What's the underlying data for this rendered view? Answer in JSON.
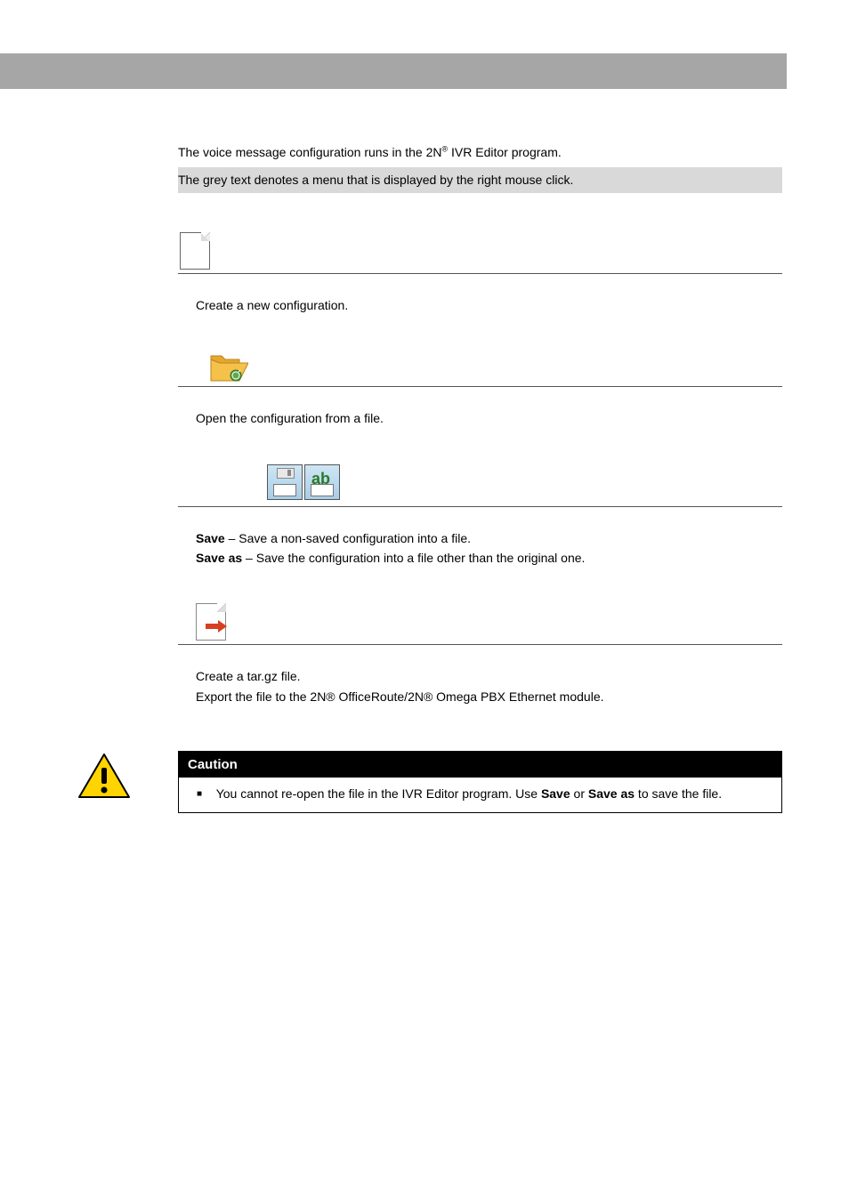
{
  "intro": {
    "line1_pre": "The voice message configuration runs in the 2N",
    "line1_sup": "®",
    "line1_post": " IVR Editor program.",
    "line2": "The grey text denotes a menu that is displayed by the right mouse click."
  },
  "sections": {
    "new": {
      "desc": "Create a new configuration."
    },
    "open": {
      "desc": "Open the configuration from a file."
    },
    "save": {
      "save_label": "Save",
      "save_desc": " – Save a non-saved configuration into a file.",
      "saveas_label": "Save as",
      "saveas_desc": " – Save the configuration into a file other than the original one.",
      "ab_text": "ab"
    },
    "export": {
      "line1": "Create a tar.gz file.",
      "line2": "Export the file to the 2N® OfficeRoute/2N® Omega PBX Ethernet module."
    }
  },
  "caution": {
    "title": "Caution",
    "text_pre": "You cannot re-open the file in the IVR Editor program. Use ",
    "save": "Save",
    "text_mid": " or ",
    "saveas": "Save as",
    "text_post": " to save the file."
  }
}
